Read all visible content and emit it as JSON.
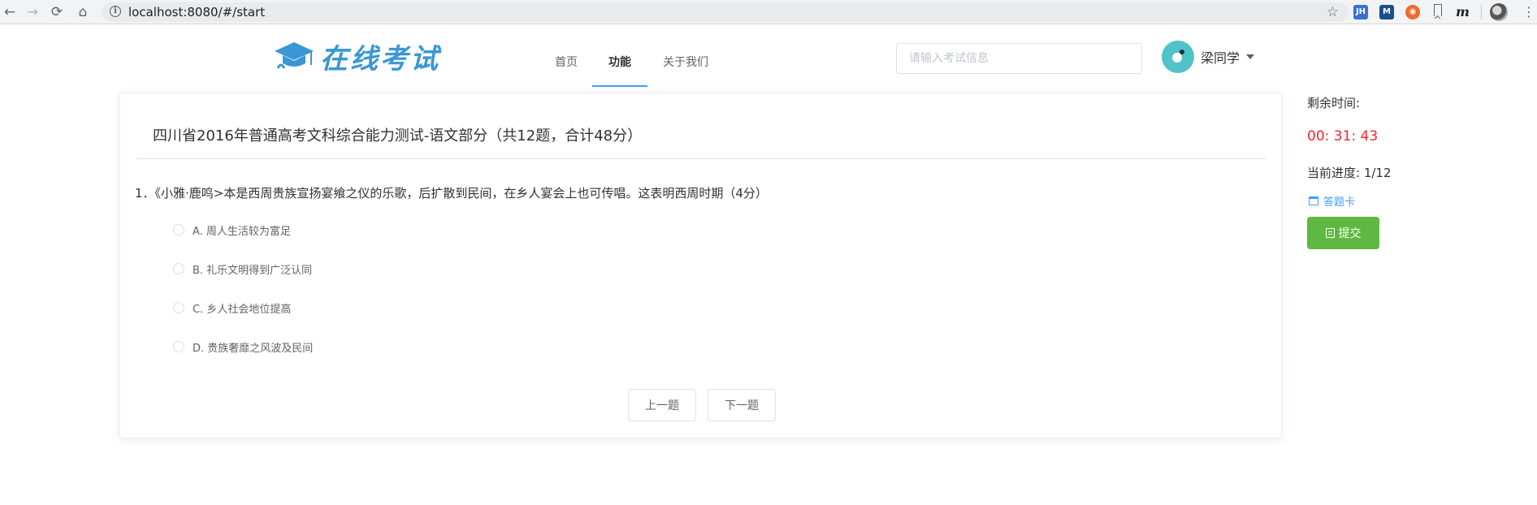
{
  "browser": {
    "url": "localhost:8080/#/start",
    "back_icon": "←",
    "forward_icon": "→",
    "reload_icon": "⟳",
    "home_icon": "⌂",
    "star_icon": "☆",
    "menu_icon": "⋮",
    "extensions": [
      {
        "name": "jh-extension-icon",
        "label": "JH",
        "color": "#3b6fd8"
      },
      {
        "name": "m-extension-icon",
        "label": "M",
        "color": "#1b4f8c"
      },
      {
        "name": "orange-extension-icon",
        "label": "◉",
        "color": "#f06a2a"
      }
    ],
    "m_italic": "m"
  },
  "header": {
    "logo_text": "在线考试",
    "nav": [
      "首页",
      "功能",
      "关于我们"
    ],
    "active_nav": "功能",
    "search_placeholder": "请输入考试信息",
    "user_name": "梁同学"
  },
  "exam": {
    "title": "四川省2016年普通高考文科综合能力测试-语文部分（共12题，合计48分）",
    "question": "1．《小雅·鹿鸣>本是西周贵族宣扬宴飨之仪的乐歌，后扩散到民间，在乡人宴会上也可传唱。这表明西周时期（4分）",
    "options": [
      "A. 周人生活较为富足",
      "B. 礼乐文明得到广泛认同",
      "C. 乡人社会地位提高",
      "D. 贵族奢靡之风波及民间"
    ],
    "prev_label": "上一题",
    "next_label": "下一题"
  },
  "side": {
    "remaining_label": "剩余时间:",
    "timer": "00: 31: 43",
    "progress_label": "当前进度: 1/12",
    "answer_card_label": "答题卡",
    "submit_label": "提交"
  },
  "colors": {
    "brand": "#3a97d4",
    "active_underline": "#409eff",
    "timer": "#f2262b",
    "submit": "#5eb841"
  }
}
